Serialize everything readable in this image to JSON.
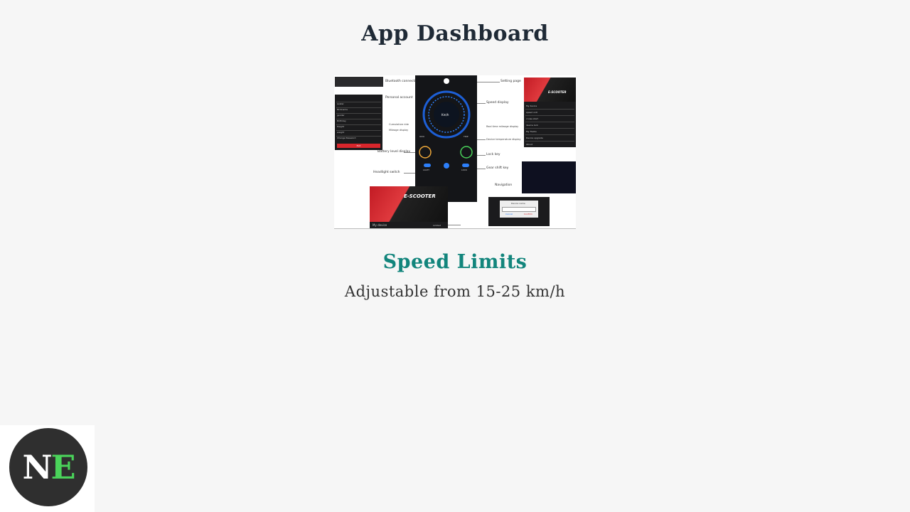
{
  "page": {
    "title": "App Dashboard",
    "heading": "Speed Limits",
    "subtext": "Adjustable from 15-25 km/h"
  },
  "infographic": {
    "annotations": {
      "bluetooth": "Bluetooth connection",
      "personal_account": "Personal account",
      "cumulative": "Cumulative ride",
      "mileage": "Mileage display",
      "battery": "Battery level display",
      "headlight": "Headlight switch",
      "setting_page": "Setting page",
      "speed_display": "Speed display",
      "realtime_mileage": "Real time mileage display",
      "device_temp": "Device temperature display",
      "lock_key": "Lock key",
      "gear_shift": "Gear shift key",
      "navigation": "Navigation"
    },
    "profile_rows": [
      "Avatar",
      "Nickname",
      "gender",
      "Birthday",
      "Height",
      "weight",
      "Change Password"
    ],
    "settings_rows": [
      "My device",
      "speed unit",
      "cruise start",
      "device lock",
      "My Tracks",
      "Device upgrade",
      "About"
    ],
    "speed_unit": "Km/h",
    "trip_left": "ODO",
    "trip_right": "TRIP",
    "light_label": "LIGHT",
    "lock_label": "LOCK",
    "escooter": "E-SCOOTER",
    "my_device": "My device",
    "limited": "Limited",
    "exit_label": "Exit",
    "dialog_title": "Device name",
    "dialog_cancel": "Cancel",
    "dialog_confirm": "Confirm"
  },
  "logo": {
    "letter_1": "N",
    "letter_2": "E",
    "colors": {
      "circle": "#2f2f2f",
      "n": "#ffffff",
      "e": "#4ad35a"
    }
  },
  "colors": {
    "background": "#f6f6f6",
    "title": "#1f2a36",
    "heading": "#12857c",
    "accent_blue": "#2d7ff9",
    "accent_red": "#d8262c"
  }
}
